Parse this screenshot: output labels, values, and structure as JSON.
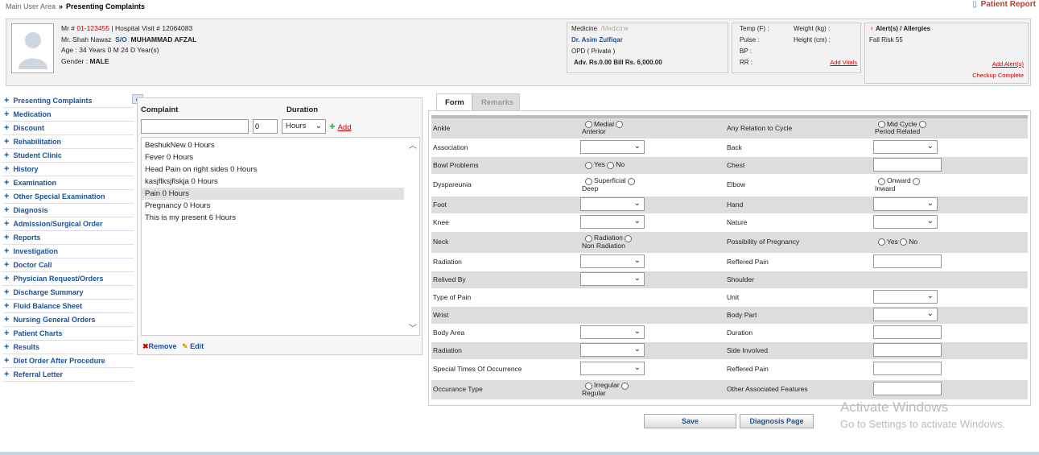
{
  "breadcrumb": {
    "parent": "Main User Area",
    "sep": "»",
    "current": "Presenting Complaints"
  },
  "patient_report": "Patient Report",
  "patient": {
    "mr_label": "Mr #",
    "mr_no": "01-123455",
    "visit": "| Hospital Visit # 12064083",
    "name": "Mr. Shah Nawaz",
    "so": "S/O",
    "father": "MUHAMMAD AFZAL",
    "age": "Age : 34 Years 0 M 24 D Year(s)",
    "gender_label": "Gender :",
    "gender": "MALE"
  },
  "medicine": {
    "dept": "Medicine",
    "sub": "/Medicine",
    "doctor": "Dr. Asim Zulfiqar",
    "opd": "OPD ( Private )",
    "bill": "Adv. Rs.0.00 Bill Rs. 6,000.00"
  },
  "vitals": {
    "temp": "Temp (F) :",
    "weight": "Weight (kg) :",
    "pulse": "Pulse :",
    "height": "Height (cm) :",
    "bp": "BP :",
    "rr": "RR :",
    "add": "Add Vitals"
  },
  "alerts": {
    "title": "Alert(s) / Allergies",
    "item": "Fall Risk 55",
    "add": "Add Alert(s)",
    "checkup": "Checkup Complete"
  },
  "sidebar": {
    "collapse": "«",
    "items": [
      {
        "label": "Presenting Complaints"
      },
      {
        "label": "Medication"
      },
      {
        "label": "Discount"
      },
      {
        "label": "Rehabilitation"
      },
      {
        "label": "Student Clinic"
      },
      {
        "label": "History"
      },
      {
        "label": "Examination"
      },
      {
        "label": "Other Special Examination"
      },
      {
        "label": "Diagnosis"
      },
      {
        "label": "Admission/Surgical Order"
      },
      {
        "label": "Reports"
      },
      {
        "label": "Investigation"
      },
      {
        "label": "Doctor Call"
      },
      {
        "label": "Physician Request/Orders"
      },
      {
        "label": "Discharge Summary"
      },
      {
        "label": "Fluid Balance Sheet"
      },
      {
        "label": "Nursing General Orders"
      },
      {
        "label": "Patient Charts"
      },
      {
        "label": "Results"
      },
      {
        "label": "Diet Order After Procedure"
      },
      {
        "label": "Referral Letter"
      }
    ]
  },
  "complaint": {
    "complaint_label": "Complaint",
    "duration_label": "Duration",
    "duration_value": "0",
    "unit": "Hours",
    "add": "Add",
    "items": [
      "BeshukNew 0 Hours",
      "Fever 0 Hours",
      "Head Pain on right sides 0 Hours",
      "kasjflksjflskja 0 Hours",
      "Pain 0 Hours",
      "Pregnancy 0 Hours",
      "This is my present 6 Hours"
    ],
    "remove": "Remove",
    "edit": "Edit"
  },
  "tabs": {
    "form": "Form",
    "remarks": "Remarks"
  },
  "form": {
    "ankle": "Ankle",
    "ankle_o1": "Medial",
    "ankle_o2": "Anterior",
    "relation": "Any Relation to Cycle",
    "rel_o1": "Mid Cycle",
    "rel_o2": "Period Related",
    "association": "Association",
    "back": "Back",
    "bowl": "Bowl Problems",
    "yes": "Yes",
    "no": "No",
    "chest": "Chest",
    "dysp": "Dyspareunia",
    "dysp_o1": "Superficial",
    "dysp_o2": "Deep",
    "elbow": "Elbow",
    "elb_o1": "Onward",
    "elb_o2": "Inward",
    "foot": "Foot",
    "hand": "Hand",
    "knee": "Knee",
    "nature": "Nature",
    "neck": "Neck",
    "neck_o1": "Radiation",
    "neck_o2": "Non Radiation",
    "preg": "Possibility of Pregnancy",
    "radiation": "Radiation",
    "reffered_pain": "Reffered Pain",
    "relived": "Relived By",
    "shoulder": "Shoulder",
    "type_pain": "Type of Pain",
    "unit": "Unit",
    "wrist": "Wrist",
    "body_part": "Body Part",
    "body_area": "Body Area",
    "duration": "Duration",
    "side": "Side Involved",
    "special": "Special Times Of Occurrence",
    "occ": "Occurance Type",
    "occ_o1": "Irregular",
    "occ_o2": "Regular",
    "other": "Other Associated Features"
  },
  "buttons": {
    "save": "Save",
    "diag": "Diagnosis Page"
  },
  "watermark": {
    "l1": "Activate Windows",
    "l2": "Go to Settings to activate Windows."
  }
}
